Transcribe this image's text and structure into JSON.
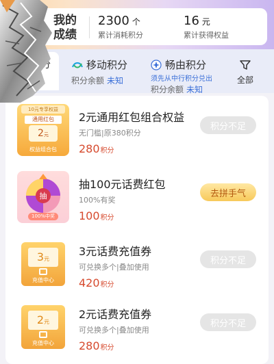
{
  "stats": {
    "title_line1": "我的",
    "title_line2": "成绩",
    "consumed_value": "2300",
    "consumed_unit": "个",
    "consumed_label": "累计消耗积分",
    "earned_value": "16",
    "earned_unit": "元",
    "earned_label": "累计获得权益"
  },
  "tabs": {
    "selected_label": "分",
    "mobile": {
      "label": "移动积分",
      "balance_label": "积分余额",
      "balance_value": "未知"
    },
    "free": {
      "label": "畅由积分",
      "note": "须先从中行积分兑出",
      "balance_label": "积分余额",
      "balance_value": "未知"
    },
    "all_label": "全部"
  },
  "items": [
    {
      "title": "2元通用红包组合权益",
      "desc": "无门槛|原380积分",
      "price": "280",
      "price_unit": "积分",
      "button": "积分不足",
      "thumb": {
        "header": "10元专享权益",
        "label": "通用红包",
        "amount": "2",
        "unit": "元",
        "footer": "权益组合包"
      }
    },
    {
      "title": "抽100元话费红包",
      "desc": "100%有奖",
      "price": "100",
      "price_unit": "积分",
      "button": "去拼手气",
      "thumb": {
        "center": "抽",
        "badge": "100%中奖"
      }
    },
    {
      "title": "3元话费充值券",
      "desc": "可兑换多个|叠加使用",
      "price": "420",
      "price_unit": "积分",
      "button": "积分不足",
      "thumb": {
        "amount": "3",
        "unit": "元",
        "footer": "充值中心"
      }
    },
    {
      "title": "2元话费充值券",
      "desc": "可兑换多个|叠加使用",
      "price": "280",
      "price_unit": "积分",
      "button": "积分不足",
      "thumb": {
        "amount": "2",
        "unit": "元",
        "footer": "充值中心"
      }
    }
  ],
  "colors": {
    "price": "#d64a2e",
    "accent_blue": "#3a6fd8",
    "button_disabled": "#e5e5e5",
    "button_active": "#f7c95a"
  }
}
